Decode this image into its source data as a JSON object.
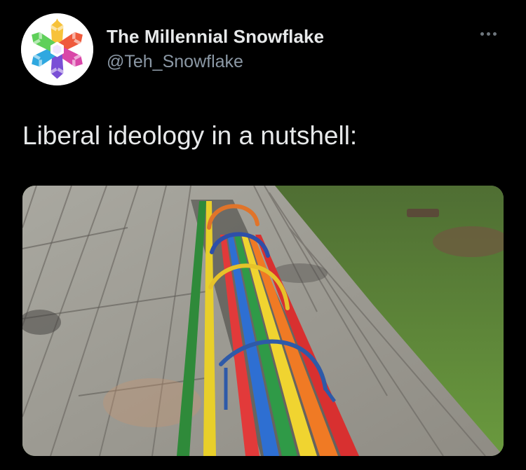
{
  "tweet": {
    "author": {
      "display_name": "The Millennial Snowflake",
      "handle": "@Teh_Snowflake",
      "avatar_icon": "rainbow-snowflake-icon"
    },
    "more_icon": "more-dots-icon",
    "text": "Liberal ideology in a nutshell:",
    "media": {
      "image": "rainbow-bench-photo",
      "bench_stripe_colors": [
        "#2f8a3a",
        "#e8cf2a",
        "#e23a3a",
        "#2e6fd2",
        "#2f9a47",
        "#f0d430",
        "#f07a24",
        "#d83030"
      ]
    }
  },
  "colors": {
    "background": "#000000",
    "primary_text": "#e7e9ea",
    "secondary_text": "#8b98a5"
  }
}
